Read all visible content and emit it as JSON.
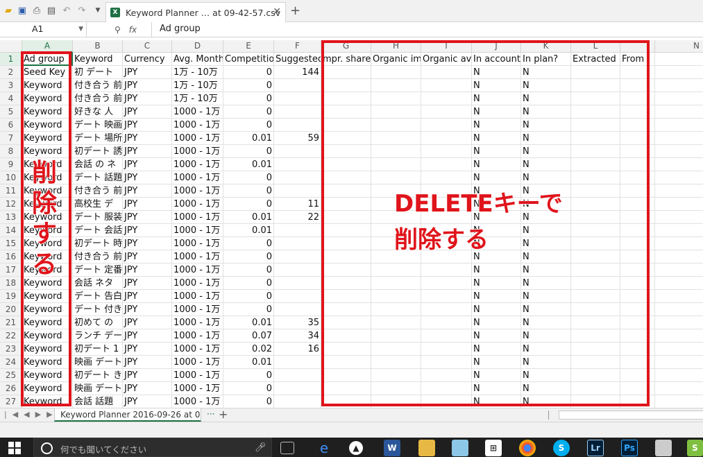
{
  "titlebar": {
    "tab_title": "Keyword Planner … at 09-42-57.csv",
    "close_glyph": "✕",
    "add_glyph": "+"
  },
  "formulabar": {
    "cell_ref": "A1",
    "fx_label": "fx",
    "value": "Ad group"
  },
  "sheet": {
    "column_letters": [
      "A",
      "B",
      "C",
      "D",
      "E",
      "F",
      "G",
      "H",
      "I",
      "J",
      "K",
      "L",
      "",
      "N"
    ],
    "headers": [
      "Ad group",
      "Keyword",
      "Currency",
      "Avg. Monthly",
      "Competition",
      "Suggested",
      "mpr. share",
      "Organic im",
      "Organic av",
      "In account",
      "In plan?",
      "Extracted",
      "From",
      ""
    ],
    "rows": [
      [
        "Seed Key",
        "初 デート",
        "JPY",
        "1万 - 10万",
        "0",
        "144",
        "",
        "",
        "",
        "N",
        "N",
        "",
        "",
        ""
      ],
      [
        "Keyword",
        "付き合う 前",
        "JPY",
        "1万 - 10万",
        "0",
        "",
        "",
        "",
        "",
        "N",
        "N",
        "",
        "",
        ""
      ],
      [
        "Keyword",
        "付き合う 前",
        "JPY",
        "1万 - 10万",
        "0",
        "",
        "",
        "",
        "",
        "N",
        "N",
        "",
        "",
        ""
      ],
      [
        "Keyword",
        "好きな 人",
        "JPY",
        "1000 - 1万",
        "0",
        "",
        "",
        "",
        "",
        "N",
        "N",
        "",
        "",
        ""
      ],
      [
        "Keyword",
        "デート 映画",
        "JPY",
        "1000 - 1万",
        "0",
        "",
        "",
        "",
        "",
        "N",
        "N",
        "",
        "",
        ""
      ],
      [
        "Keyword",
        "デート 場所",
        "JPY",
        "1000 - 1万",
        "0.01",
        "59",
        "",
        "",
        "",
        "N",
        "N",
        "",
        "",
        ""
      ],
      [
        "Keyword",
        "初デート 誘",
        "JPY",
        "1000 - 1万",
        "0",
        "",
        "",
        "",
        "",
        "N",
        "N",
        "",
        "",
        ""
      ],
      [
        "Keyword",
        "会話 の ネ",
        "JPY",
        "1000 - 1万",
        "0.01",
        "",
        "",
        "",
        "",
        "N",
        "N",
        "",
        "",
        ""
      ],
      [
        "Keyword",
        "デート 話題",
        "JPY",
        "1000 - 1万",
        "0",
        "",
        "",
        "",
        "",
        "N",
        "N",
        "",
        "",
        ""
      ],
      [
        "Keyword",
        "付き合う 前",
        "JPY",
        "1000 - 1万",
        "0",
        "",
        "",
        "",
        "",
        "N",
        "N",
        "",
        "",
        ""
      ],
      [
        "Keyword",
        "高校生 デ",
        "JPY",
        "1000 - 1万",
        "0",
        "11",
        "",
        "",
        "",
        "N",
        "N",
        "",
        "",
        ""
      ],
      [
        "Keyword",
        "デート 服装",
        "JPY",
        "1000 - 1万",
        "0.01",
        "22",
        "",
        "",
        "",
        "N",
        "N",
        "",
        "",
        ""
      ],
      [
        "Keyword",
        "デート 会話",
        "JPY",
        "1000 - 1万",
        "0.01",
        "",
        "",
        "",
        "",
        "N",
        "N",
        "",
        "",
        ""
      ],
      [
        "Keyword",
        "初デート 時",
        "JPY",
        "1000 - 1万",
        "0",
        "",
        "",
        "",
        "",
        "N",
        "N",
        "",
        "",
        ""
      ],
      [
        "Keyword",
        "付き合う 前",
        "JPY",
        "1000 - 1万",
        "0",
        "",
        "",
        "",
        "",
        "N",
        "N",
        "",
        "",
        ""
      ],
      [
        "Keyword",
        "デート 定番",
        "JPY",
        "1000 - 1万",
        "0",
        "",
        "",
        "",
        "",
        "N",
        "N",
        "",
        "",
        ""
      ],
      [
        "Keyword",
        "会話 ネタ",
        "JPY",
        "1000 - 1万",
        "0",
        "",
        "",
        "",
        "",
        "N",
        "N",
        "",
        "",
        ""
      ],
      [
        "Keyword",
        "デート 告白",
        "JPY",
        "1000 - 1万",
        "0",
        "",
        "",
        "",
        "",
        "N",
        "N",
        "",
        "",
        ""
      ],
      [
        "Keyword",
        "デート 付き",
        "JPY",
        "1000 - 1万",
        "0",
        "",
        "",
        "",
        "",
        "N",
        "N",
        "",
        "",
        ""
      ],
      [
        "Keyword",
        "初めて の",
        "JPY",
        "1000 - 1万",
        "0.01",
        "35",
        "",
        "",
        "",
        "N",
        "N",
        "",
        "",
        ""
      ],
      [
        "Keyword",
        "ランチ デー",
        "JPY",
        "1000 - 1万",
        "0.07",
        "34",
        "",
        "",
        "",
        "N",
        "N",
        "",
        "",
        ""
      ],
      [
        "Keyword",
        "初デート 1",
        "JPY",
        "1000 - 1万",
        "0.02",
        "16",
        "",
        "",
        "",
        "N",
        "N",
        "",
        "",
        ""
      ],
      [
        "Keyword",
        "映画 デート",
        "JPY",
        "1000 - 1万",
        "0.01",
        "",
        "",
        "",
        "",
        "N",
        "N",
        "",
        "",
        ""
      ],
      [
        "Keyword",
        "初デート き",
        "JPY",
        "1000 - 1万",
        "0",
        "",
        "",
        "",
        "",
        "N",
        "N",
        "",
        "",
        ""
      ],
      [
        "Keyword",
        "映画 デート",
        "JPY",
        "1000 - 1万",
        "0",
        "",
        "",
        "",
        "",
        "N",
        "N",
        "",
        "",
        ""
      ],
      [
        "Keyword",
        "会話 話題",
        "JPY",
        "1000 - 1万",
        "0",
        "",
        "",
        "",
        "",
        "N",
        "N",
        "",
        "",
        ""
      ]
    ]
  },
  "annotations": {
    "left_vertical": [
      "削",
      "除",
      "す",
      "る"
    ],
    "right_line1": "DELETEキーで",
    "right_line2": "削除する",
    "color": "#e0141b"
  },
  "sheettabs": {
    "active_tab": "Keyword Planner 2016-09-26 at 0",
    "more": "···",
    "add": "+"
  },
  "taskbar": {
    "search_placeholder": "何でも聞いてください",
    "icons": [
      "edge-icon",
      "word-icon",
      "explorer-icon",
      "store-icon",
      "chrome-icon",
      "skype-icon",
      "lightroom-icon",
      "photoshop-icon"
    ]
  },
  "colors": {
    "accent": "#1e7145",
    "annotation": "#e0141b"
  }
}
